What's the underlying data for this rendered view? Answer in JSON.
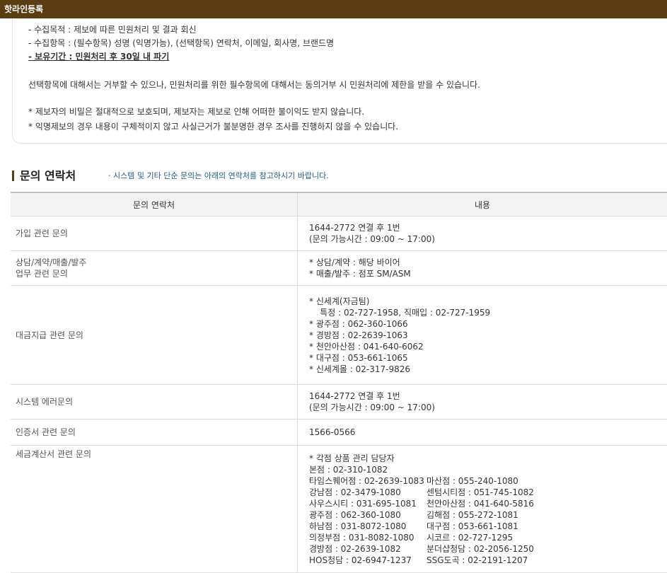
{
  "window": {
    "title": "핫라인등록"
  },
  "notice": {
    "lines": [
      "- 수집목적 : 제보에 따른 민원처리 및 결과 회신",
      "- 수집항목 : (필수항목) 성명 (익명가능), (선택항목) 연락처, 이메일, 회사명, 브랜드명",
      "- 보유기간 : 민원처리 후 30일 내 파기",
      "선택항목에 대해서는 거부할 수 있으나, 민원처리를 위한 필수항목에 대해서는 동의거부 시 민원처리에 제한을 받을 수 있습니다.",
      "* 제보자의 비밀은 절대적으로 보호되며, 제보자는 제보로 인해 어떠한 불이익도 받지 않습니다.",
      "* 익명제보의 경우 내용이 구체적이지 않고 사실근거가 불분명한 경우 조사를 진행하지 않을 수 있습니다."
    ]
  },
  "section": {
    "title": "문의 연락처",
    "desc": "· 시스템 및 기타 단순 문의는 아래의 연락처를 참고하시기 바랍니다."
  },
  "table": {
    "headers": [
      "문의 연락처",
      "내용"
    ],
    "rows": [
      {
        "label": "가입 관련 문의",
        "content": "1644-2772 연결 후 1번\n(문의 가능시간 : 09:00 ~ 17:00)"
      },
      {
        "label": "상담/계약/매출/발주\n업무 관련 문의",
        "content": "* 상담/계약 : 해당 바이어\n* 매출/발주 : 점포 SM/ASM"
      },
      {
        "label": "대금지급 관련 문의",
        "content": "* 신세계(자금팀)\n    특정 : 02-727-1958, 직매입 : 02-727-1959\n* 광주점 : 062-360-1066\n* 경방점 : 02-2639-1063\n* 천안아산점 : 041-640-6062\n* 대구점 : 053-661-1065\n* 신세계몰 : 02-317-9826"
      },
      {
        "label": "시스템 에러문의",
        "content": "1644-2772 연결 후 1번\n(문의 가능시간 : 09:00 ~ 17:00)"
      },
      {
        "label": "인증서 관련 문의",
        "content": "1566-0566"
      },
      {
        "label": "세금계산서 관련 문의",
        "content_intro": "* 각점 상품 관리 담당자",
        "content_main": "본점 : 02-310-1082",
        "content_pairs": [
          [
            "타임스퀘어점 : 02-2639-1083",
            "마산점 : 055-240-1080"
          ],
          [
            "강남점 : 02-3479-1080",
            "센텀시티점 : 051-745-1082"
          ],
          [
            "사우스시티 : 031-695-1081",
            "천안아산점 : 041-640-5816"
          ],
          [
            "광주점 : 062-360-1080",
            "김해점 : 055-272-1081"
          ],
          [
            "하남점 : 031-8072-1080",
            "대구점 : 053-661-1081"
          ],
          [
            "의정부점 : 031-8082-1080",
            "시코르 : 02-727-1295"
          ],
          [
            "경방점 : 02-2639-1082",
            "분더샵청담 : 02-2056-1250"
          ],
          [
            "HOS청담 : 02-6947-1237",
            "SSG도곡 : 02-2191-1207"
          ]
        ]
      }
    ]
  }
}
